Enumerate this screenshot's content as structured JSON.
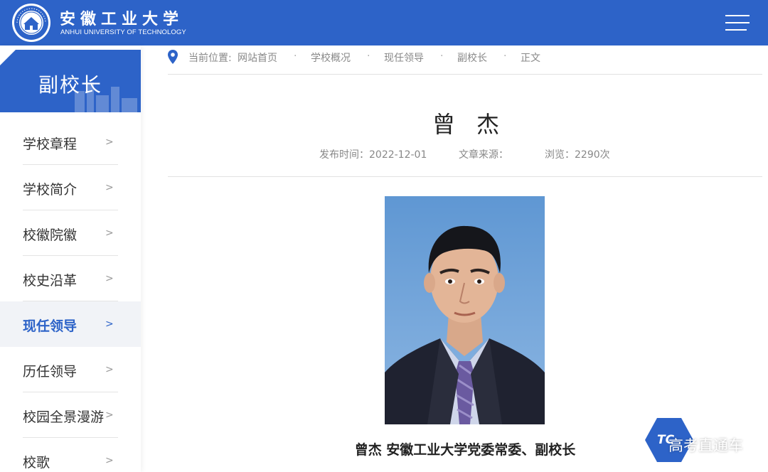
{
  "header": {
    "logo_cn": "安徽工业大学",
    "logo_en": "ANHUI UNIVERSITY OF TECHNOLOGY",
    "brand_color": "#2d63c8"
  },
  "sidebar": {
    "title": "副校长",
    "items": [
      {
        "label": "学校章程",
        "arrow": ">"
      },
      {
        "label": "学校简介",
        "arrow": ">"
      },
      {
        "label": "校徽院徽",
        "arrow": ">"
      },
      {
        "label": "校史沿革",
        "arrow": ">"
      },
      {
        "label": "现任领导",
        "arrow": ">",
        "active": true
      },
      {
        "label": "历任领导",
        "arrow": ">"
      },
      {
        "label": "校园全景漫游",
        "arrow": ">"
      },
      {
        "label": "校歌",
        "arrow": ">"
      }
    ]
  },
  "breadcrumb": {
    "prefix": "当前位置:",
    "items": [
      "网站首页",
      "学校概况",
      "现任领导",
      "副校长",
      "正文"
    ],
    "separator": "·"
  },
  "article": {
    "title": "曾杰",
    "publish_label": "发布时间：2022-12-01",
    "source_label": "文章来源：",
    "views_label": "浏览：2290次",
    "caption": "曾杰 安徽工业大学党委常委、副校长"
  },
  "watermark": {
    "badge": "TC",
    "text": "高考直通车"
  }
}
